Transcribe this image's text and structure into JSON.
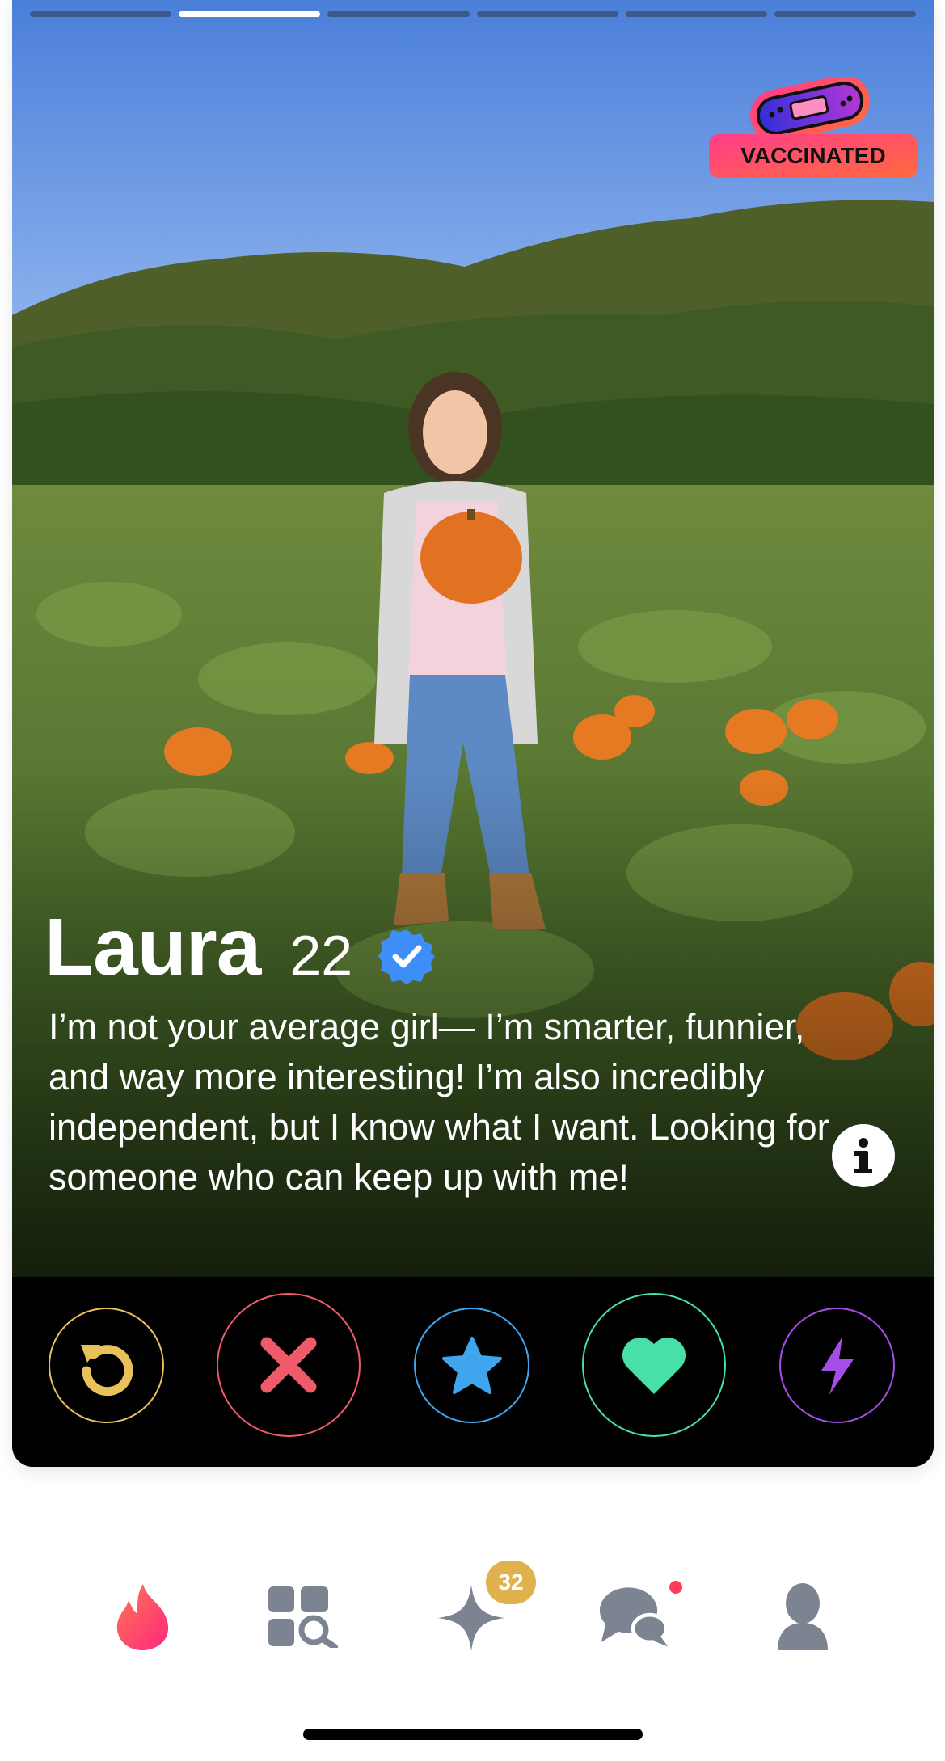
{
  "profile": {
    "name": "Laura",
    "age": "22",
    "bio": "I’m not your average girl— I’m smarter, funnier, and way more interesting! I’m also incredibly independent, but I know what I want. Looking for someone who can keep up with me!",
    "photo_count": 6,
    "active_photo": 2,
    "badge": "VACCINATED"
  },
  "actions": [
    {
      "name": "rewind-button",
      "icon": "rewind-icon",
      "color": "#e8c15a"
    },
    {
      "name": "nope-button",
      "icon": "close-icon",
      "color": "#f05b6b"
    },
    {
      "name": "super-like-button",
      "icon": "star-icon",
      "color": "#3fa6ee"
    },
    {
      "name": "like-button",
      "icon": "heart-icon",
      "color": "#47e0a7"
    },
    {
      "name": "boost-button",
      "icon": "lightning-icon",
      "color": "#a44ee8"
    }
  ],
  "nav": {
    "items": [
      "flame-icon",
      "explore-icon",
      "sparkle-icon",
      "chat-icon",
      "profile-icon"
    ],
    "likes_badge": "32",
    "accent": "#fe3c58"
  }
}
